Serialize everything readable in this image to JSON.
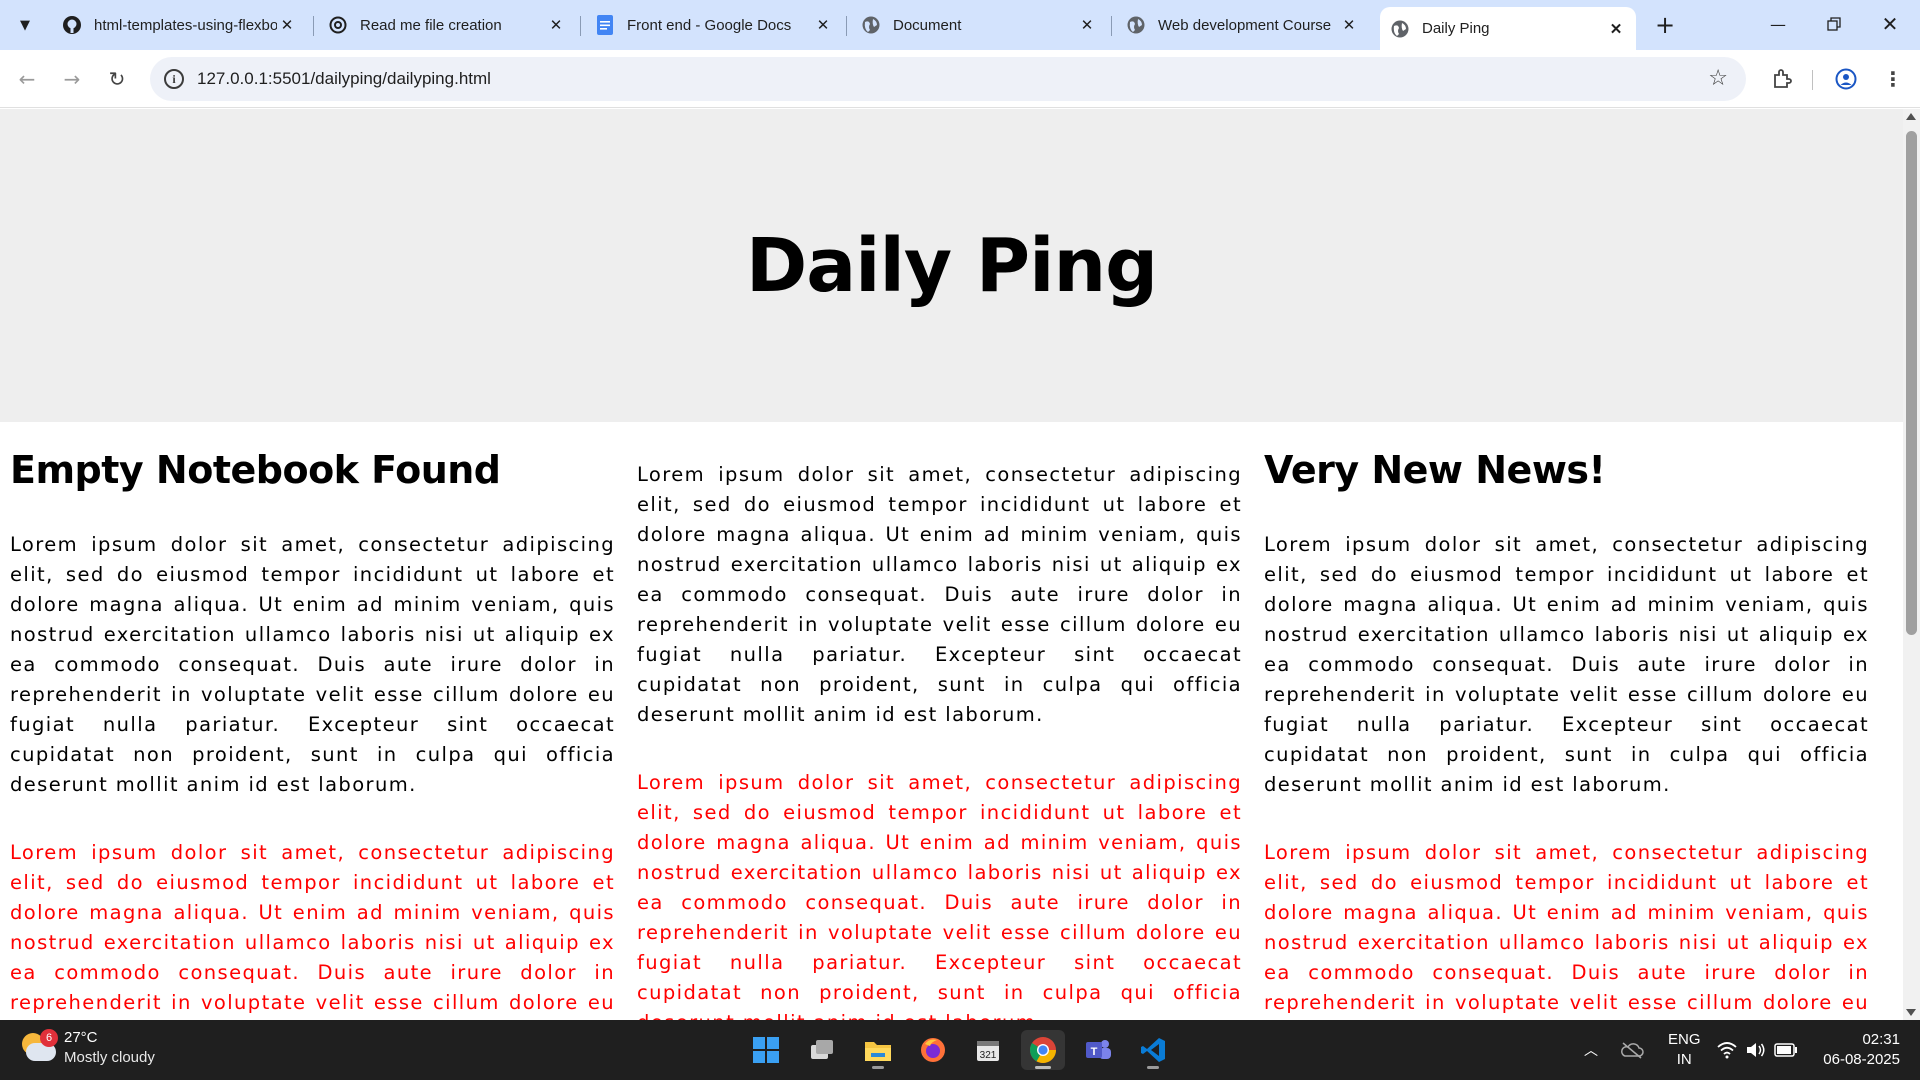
{
  "browser": {
    "tabs": [
      {
        "title": "html-templates-using-flexbox",
        "icon": "github-icon"
      },
      {
        "title": "Read me file creation",
        "icon": "openai-icon"
      },
      {
        "title": "Front end - Google Docs",
        "icon": "google-docs-icon"
      },
      {
        "title": "Document",
        "icon": "globe-icon"
      },
      {
        "title": "Web development Course",
        "icon": "globe-icon"
      },
      {
        "title": "Daily Ping",
        "icon": "globe-icon",
        "active": true
      }
    ],
    "url": "127.0.0.1:5501/dailyping/dailyping.html"
  },
  "page": {
    "header_title": "Daily Ping",
    "columns": [
      {
        "heading": "Empty Notebook Found",
        "paragraph": "Lorem ipsum dolor sit amet, consectetur adipiscing elit, sed do eiusmod tempor incididunt ut labore et dolore magna aliqua. Ut enim ad minim veniam, quis nostrud exercitation ullamco laboris nisi ut aliquip ex ea commodo consequat. Duis aute irure dolor in reprehenderit in voluptate velit esse cillum dolore eu fugiat nulla pariatur. Excepteur sint occaecat cupidatat non proident, sunt in culpa qui officia deserunt mollit anim id est laborum.",
        "red_paragraph": "Lorem ipsum dolor sit amet, consectetur adipiscing elit, sed do eiusmod tempor incididunt ut labore et dolore magna aliqua. Ut enim ad minim veniam, quis nostrud exercitation ullamco laboris nisi ut aliquip ex ea commodo consequat. Duis aute irure dolor in reprehenderit in voluptate velit esse cillum dolore eu fugiat nulla pariatur. Excepteur sint occaecat cupidatat non proident, sunt in culpa qui officia deserunt mollit anim id est laborum."
      },
      {
        "heading": "",
        "paragraph": "Lorem ipsum dolor sit amet, consectetur adipiscing elit, sed do eiusmod tempor incididunt ut labore et dolore magna aliqua. Ut enim ad minim veniam, quis nostrud exercitation ullamco laboris nisi ut aliquip ex ea commodo consequat. Duis aute irure dolor in reprehenderit in voluptate velit esse cillum dolore eu fugiat nulla pariatur. Excepteur sint occaecat cupidatat non proident, sunt in culpa qui officia deserunt mollit anim id est laborum.",
        "red_paragraph": "Lorem ipsum dolor sit amet, consectetur adipiscing elit, sed do eiusmod tempor incididunt ut labore et dolore magna aliqua. Ut enim ad minim veniam, quis nostrud exercitation ullamco laboris nisi ut aliquip ex ea commodo consequat. Duis aute irure dolor in reprehenderit in voluptate velit esse cillum dolore eu fugiat nulla pariatur. Excepteur sint occaecat cupidatat non proident, sunt in culpa qui officia deserunt mollit anim id est laborum."
      },
      {
        "heading": "Very New News!",
        "paragraph": "Lorem ipsum dolor sit amet, consectetur adipiscing elit, sed do eiusmod tempor incididunt ut labore et dolore magna aliqua. Ut enim ad minim veniam, quis nostrud exercitation ullamco laboris nisi ut aliquip ex ea commodo consequat. Duis aute irure dolor in reprehenderit in voluptate velit esse cillum dolore eu fugiat nulla pariatur. Excepteur sint occaecat cupidatat non proident, sunt in culpa qui officia deserunt mollit anim id est laborum.",
        "red_paragraph": "Lorem ipsum dolor sit amet, consectetur adipiscing elit, sed do eiusmod tempor incididunt ut labore et dolore magna aliqua. Ut enim ad minim veniam, quis nostrud exercitation ullamco laboris nisi ut aliquip ex ea commodo consequat. Duis aute irure dolor in reprehenderit in voluptate velit esse cillum dolore eu fugiat nulla pariatur. Excepteur sint occaecat cupidatat non proident, sunt in culpa qui officia deserunt mollit anim id est laborum."
      }
    ],
    "red_color": "#ff0000"
  },
  "taskbar": {
    "weather": {
      "badge": "6",
      "temp": "27°C",
      "desc": "Mostly cloudy"
    },
    "apps": [
      "windows-start-icon",
      "task-view-icon",
      "file-explorer-icon",
      "firefox-icon",
      "calendar-app-icon",
      "chrome-icon",
      "teams-icon",
      "vscode-icon"
    ],
    "lang": {
      "line1": "ENG",
      "line2": "IN"
    },
    "clock": {
      "time": "02:31",
      "date": "06-08-2025"
    }
  }
}
